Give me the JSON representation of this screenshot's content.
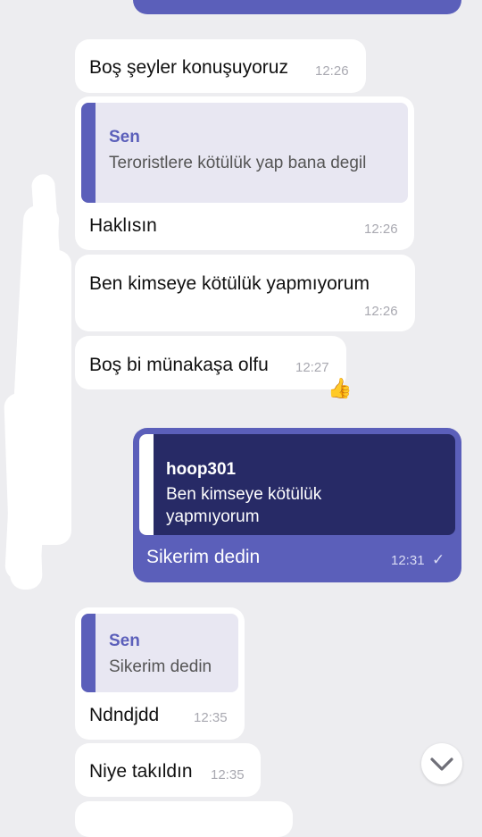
{
  "messages": [
    {
      "text": "Boş şeyler konuşuyoruz",
      "time": "12:26"
    },
    {
      "quote": {
        "author": "Sen",
        "text": "Teroristlere kötülük yap bana degil"
      },
      "text": "Haklısın",
      "time": "12:26"
    },
    {
      "text": "Ben kimseye kötülük yapmıyorum",
      "time": "12:26"
    },
    {
      "text": "Boş bi münakaşa olfu",
      "time": "12:27",
      "reaction": "👍"
    },
    {
      "quote": {
        "author": "hoop301",
        "text": "Ben kimseye kötülük yapmıyorum"
      },
      "text": "Sikerim dedin",
      "time": "12:31",
      "status": "✓"
    },
    {
      "quote": {
        "author": "Sen",
        "text": "Sikerim dedin"
      },
      "text": "Ndndjdd",
      "time": "12:35"
    },
    {
      "text": "Niye takıldın",
      "time": "12:35"
    }
  ],
  "colors": {
    "accent": "#5b5fba",
    "background": "#ededf0",
    "quote_dark": "#272a66"
  }
}
